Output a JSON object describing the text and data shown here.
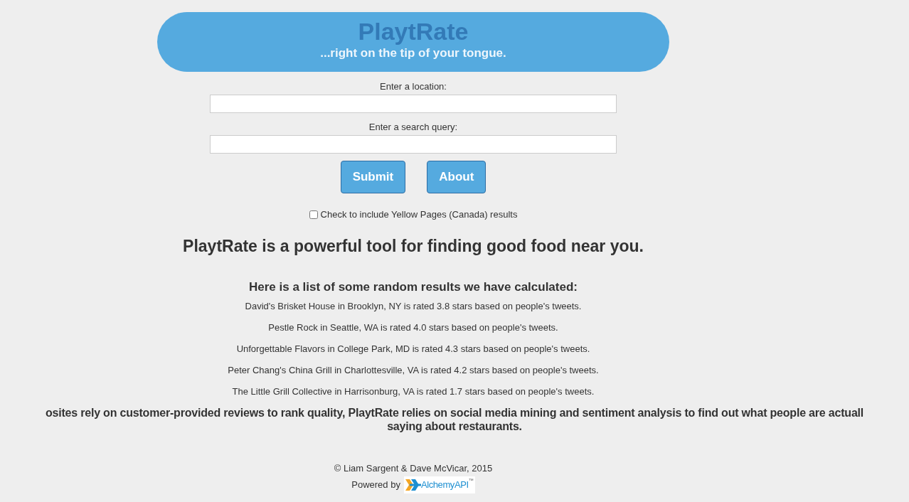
{
  "header": {
    "title": "PlaytRate",
    "tagline": "...right on the tip of your tongue."
  },
  "form": {
    "fields": [
      {
        "label": "Enter a location:"
      },
      {
        "label": "Enter a search query:"
      }
    ],
    "buttons": [
      "Submit",
      "About"
    ],
    "checkbox": {
      "label": "Check to include Yellow Pages (Canada) results",
      "checked": false
    }
  },
  "headline": "PlaytRate is a powerful tool for finding good food near you.",
  "results": {
    "heading": "Here is a list of some random results we have calculated:",
    "items": [
      "David's Brisket House in Brooklyn, NY is rated 3.8 stars based on people's tweets.",
      "Pestle Rock in Seattle, WA is rated 4.0 stars based on people's tweets.",
      "Unforgettable Flavors in College Park, MD is rated 4.3 stars based on people's tweets.",
      "Peter Chang's China Grill in Charlottesville, VA is rated 4.2 stars based on people's tweets.",
      "The Little Grill Collective in Harrisonburg, VA is rated 1.7 stars based on people's tweets."
    ]
  },
  "about_lines": [
    "osites rely on customer-provided reviews to rank quality, PlaytRate relies on social media mining and sentiment analysis to find out what people are actuall",
    "saying about restaurants."
  ],
  "footer": {
    "copyright": "© Liam Sargent & Dave McVicar, 2015",
    "powered_by": "Powered by",
    "logo_text": "AlchemyAPI",
    "logo_mark": "™"
  }
}
